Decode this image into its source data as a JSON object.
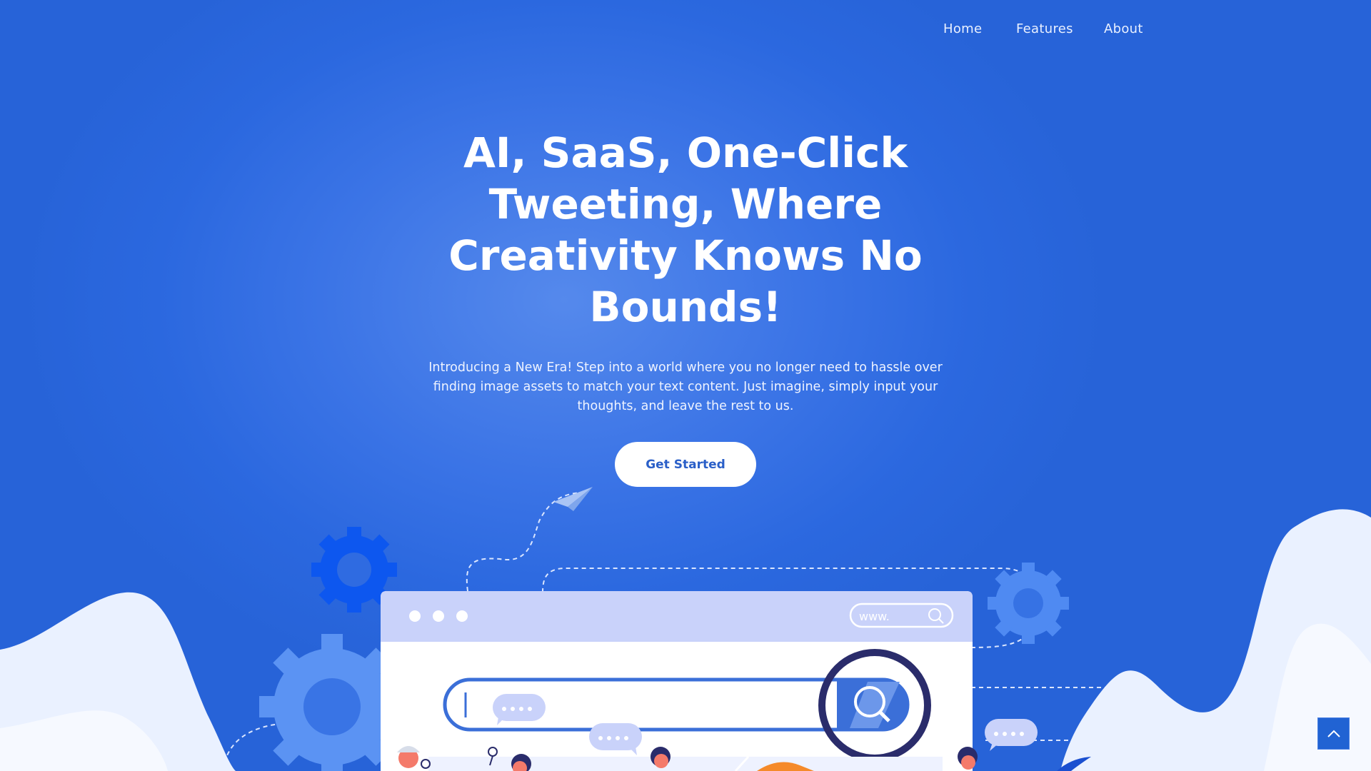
{
  "nav": {
    "items": [
      {
        "label": "Home"
      },
      {
        "label": "Features"
      },
      {
        "label": "About"
      }
    ]
  },
  "hero": {
    "title": "AI, SaaS, One-Click Tweeting, Where Creativity Knows No Bounds!",
    "subtitle": "Introducing a New Era! Step into a world where you no longer need to hassle over finding image assets to match your text content. Just imagine, simply input your thoughts, and leave the rest to us.",
    "cta_label": "Get Started"
  },
  "illustration": {
    "browser_url_text": "www."
  },
  "icons": {
    "back_to_top": "chevron-up-icon",
    "gear": "gear-icon",
    "magnifier": "magnifier-icon",
    "paper_plane": "paper-plane-icon"
  },
  "colors": {
    "background": "#2b68df",
    "accent": "#2163d3",
    "cta_text": "#2a5fc8"
  }
}
